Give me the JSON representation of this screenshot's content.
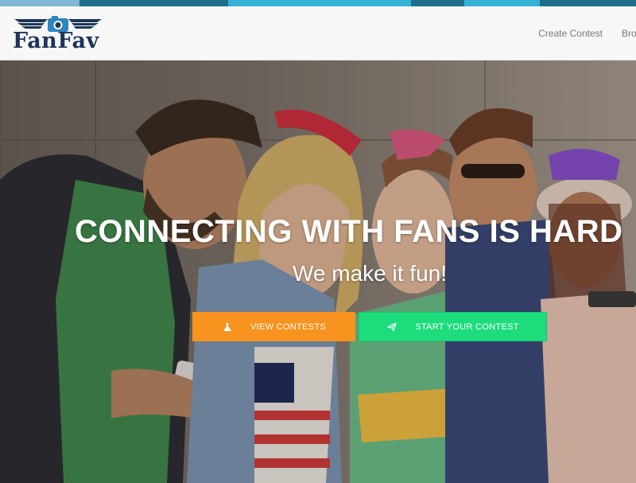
{
  "header": {
    "logo_text": "FanFav",
    "nav": {
      "create_contest": "Create Contest",
      "browse": "Browse"
    }
  },
  "hero": {
    "title": "CONNECTING WITH FANS IS HARD",
    "subtitle": "We make it fun!",
    "buttons": {
      "view_contests": {
        "label": "VIEW CONTESTS",
        "icon": "flask-icon",
        "color": "#f7931e"
      },
      "start_contest": {
        "label": "START YOUR CONTEST",
        "icon": "paper-plane-icon",
        "color": "#1ddc7c"
      }
    }
  },
  "colors": {
    "brand_navy": "#1d3557",
    "stripe_dark": "#1f6f8b",
    "stripe_light": "#35b2d6"
  }
}
